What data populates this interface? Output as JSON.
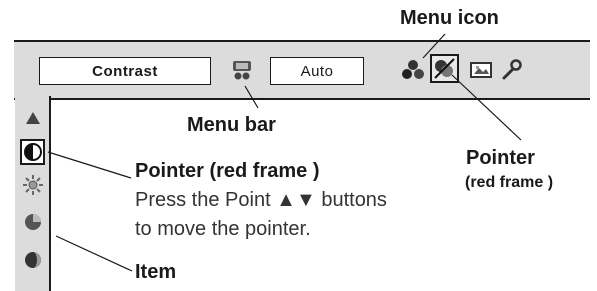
{
  "menubar": {
    "item_name": "Contrast",
    "value": "Auto"
  },
  "callouts": {
    "menu_icon": "Menu icon",
    "menu_bar": "Menu bar",
    "pointer_title": "Pointer (red frame )",
    "pointer_desc_1": "Press the Point ▲▼ buttons",
    "pointer_desc_2": "to move the pointer.",
    "pointer_right_1": "Pointer",
    "pointer_right_2": "(red frame )",
    "item": "Item"
  },
  "icons": {
    "menubar": [
      "screen-settings-icon",
      "color-balls-icon",
      "pointer-selected-icon",
      "image-icon",
      "wrench-icon"
    ],
    "items": [
      "triangle-icon",
      "half-circle-icon",
      "sun-icon",
      "color-pie-icon",
      "tint-icon"
    ]
  }
}
